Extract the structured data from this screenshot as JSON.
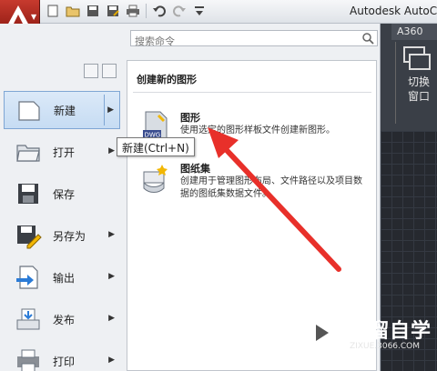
{
  "window": {
    "title": "Autodesk AutoCA"
  },
  "app_button": {
    "icon": "autocad-a-logo-icon"
  },
  "quick_access": {
    "icons": [
      "new-icon",
      "open-icon",
      "save-icon",
      "save-as-icon",
      "print-icon",
      "undo-icon",
      "redo-icon",
      "customize-icon"
    ]
  },
  "ribbon": {
    "tab_a360": "A360",
    "switch_windows_line1": "切换",
    "switch_windows_line2": "窗口"
  },
  "search": {
    "placeholder": "搜索命令"
  },
  "menu": {
    "items": [
      {
        "label": "新建",
        "icon": "new-document-icon",
        "has_arrow": true,
        "active": true
      },
      {
        "label": "打开",
        "icon": "open-folder-icon",
        "has_arrow": true
      },
      {
        "label": "保存",
        "icon": "save-disk-icon",
        "has_arrow": false
      },
      {
        "label": "另存为",
        "icon": "save-as-disk-icon",
        "has_arrow": true
      },
      {
        "label": "输出",
        "icon": "export-icon",
        "has_arrow": true
      },
      {
        "label": "发布",
        "icon": "publish-icon",
        "has_arrow": true
      },
      {
        "label": "打印",
        "icon": "print-icon",
        "has_arrow": true
      }
    ]
  },
  "content": {
    "title": "创建新的图形",
    "entries": [
      {
        "title": "图形",
        "desc": "使用选定的图形样板文件创建新图形。",
        "icon": "dwg-file-icon"
      },
      {
        "title": "图纸集",
        "desc": "创建用于管理图形布局、文件路径以及项目数据的图纸集数据文件。",
        "icon": "sheet-set-icon"
      }
    ]
  },
  "tooltip": {
    "text": "新建(Ctrl+N)"
  },
  "watermark": {
    "text": "溜溜自学",
    "sub": "ZIXUE.3066.COM"
  },
  "colors": {
    "accent_red": "#e8302a",
    "menu_active": "#c6dcf3",
    "app_button": "#b32b20"
  }
}
